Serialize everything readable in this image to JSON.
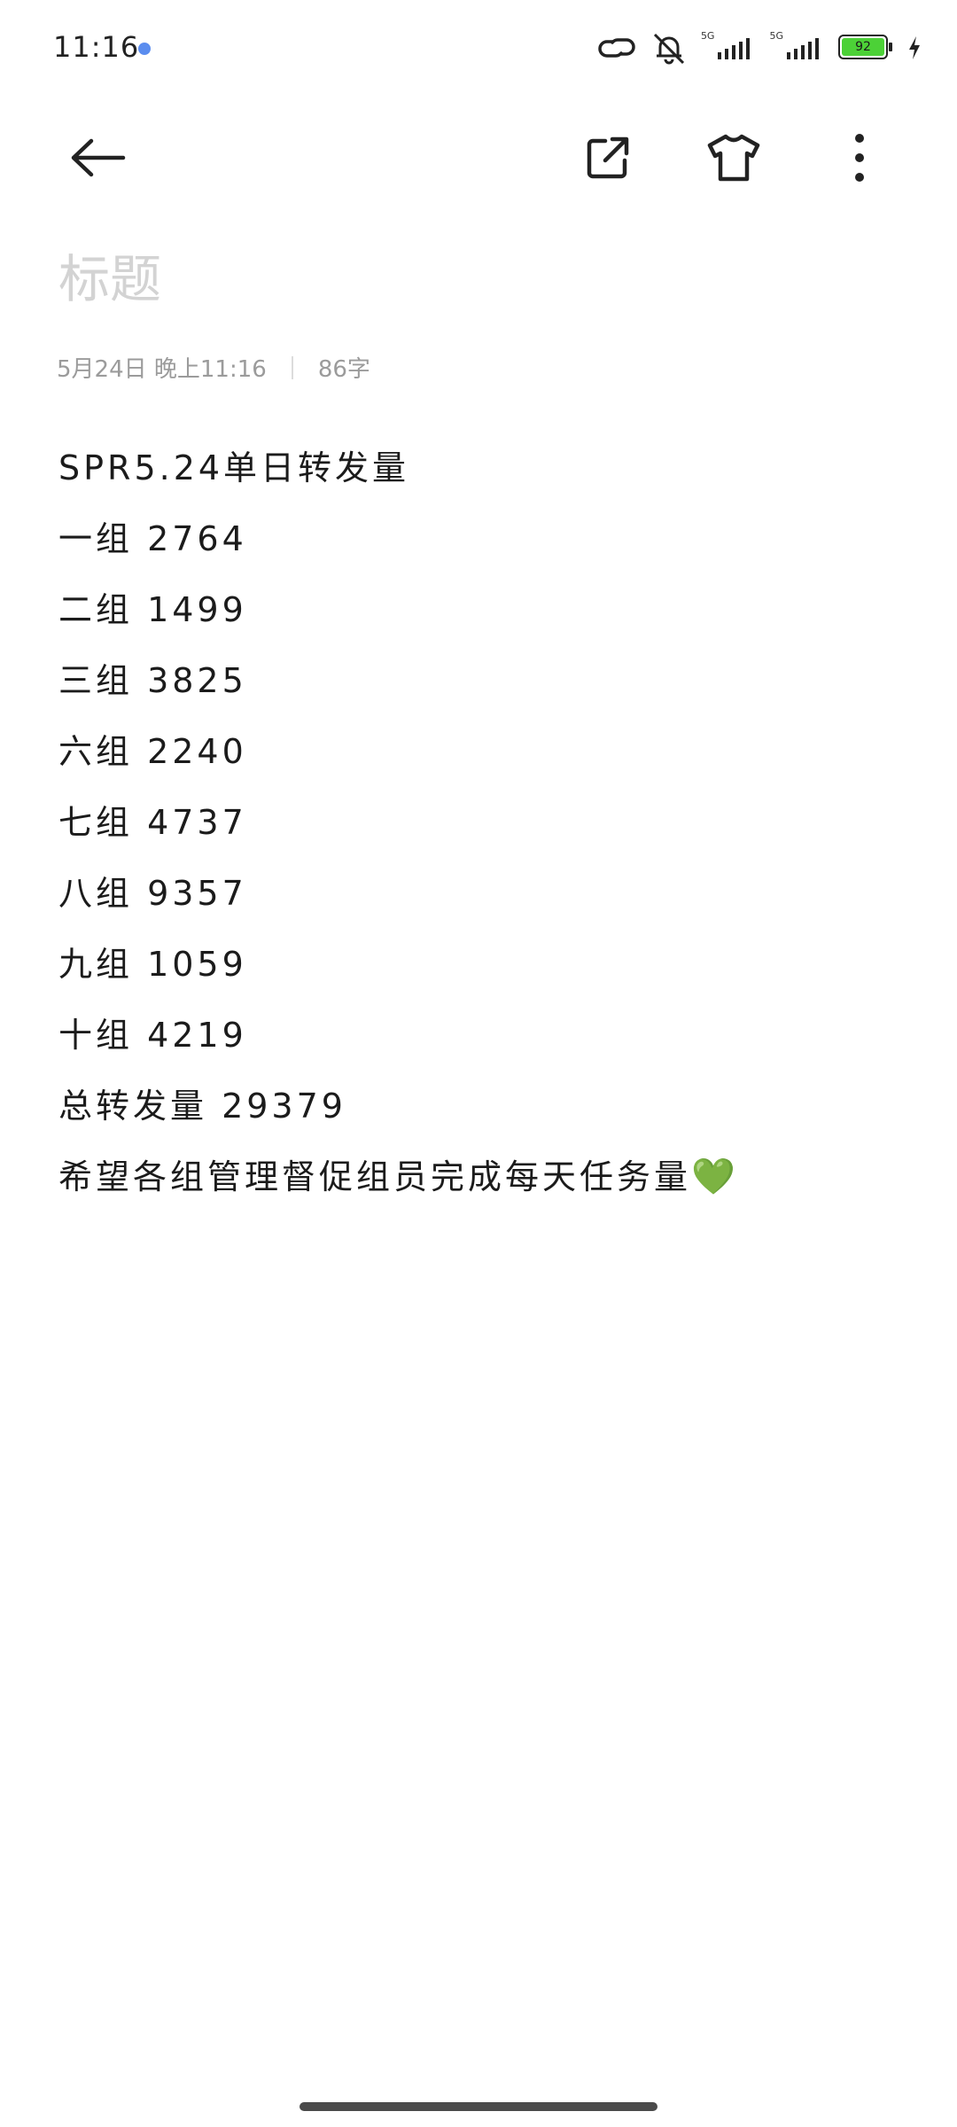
{
  "status_bar": {
    "time": "11:16",
    "network_label_1": "5G",
    "network_label_2": "5G",
    "battery_percent": "92"
  },
  "note": {
    "title_placeholder": "标题",
    "date": "5月24日 晚上11:16",
    "char_count": "86字",
    "lines": [
      "SPR5.24单日转发量",
      "一组 2764",
      "二组 1499",
      "三组 3825",
      "六组 2240",
      "七组 4737",
      "八组 9357",
      "九组 1059",
      "十组 4219",
      "总转发量 29379",
      "希望各组管理督促组员完成每天任务量"
    ],
    "emoji": "💚"
  },
  "colors": {
    "battery_fill": "#4cd137",
    "heart": "#6dc24b",
    "placeholder": "#d3d3d3"
  }
}
